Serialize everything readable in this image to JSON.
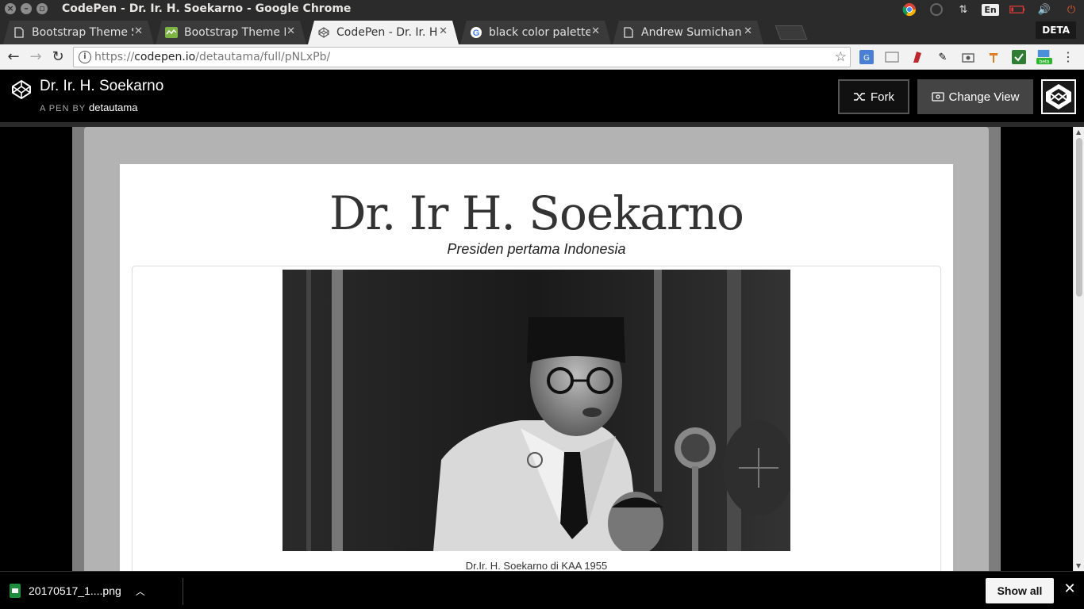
{
  "window": {
    "title": "CodePen - Dr. Ir. H. Soekarno - Google Chrome",
    "close_glyph": "×",
    "min_glyph": "–",
    "max_glyph": "▫"
  },
  "tray": {
    "lang": "En",
    "icons": [
      "chrome-icon",
      "network-icon",
      "transfer-icon",
      "keyboard-icon",
      "battery-icon",
      "volume-icon",
      "power-icon"
    ]
  },
  "tabs": [
    {
      "label": "Bootstrap Theme Sk",
      "icon": "document-icon",
      "active": false
    },
    {
      "label": "Bootstrap Theme Re",
      "icon": "bootstrap-icon",
      "active": false
    },
    {
      "label": "CodePen - Dr. Ir. H.",
      "icon": "codepen-icon",
      "active": true
    },
    {
      "label": "black color palette",
      "icon": "google-icon",
      "active": false
    },
    {
      "label": "Andrew Sumichan |",
      "icon": "document-icon",
      "active": false
    }
  ],
  "profile_label": "DETA",
  "address": {
    "scheme": "https://",
    "host": "codepen.io",
    "path": "/detautama/full/pNLxPb/"
  },
  "codepen": {
    "pen_title": "Dr. Ir. H. Soekarno",
    "by_label": "A PEN BY",
    "author": "detautama",
    "fork_label": "Fork",
    "change_view_label": "Change View"
  },
  "page": {
    "heading": "Dr. Ir H. Soekarno",
    "subheading": "Presiden pertama Indonesia",
    "image_caption": "Dr.Ir. H. Soekarno di KAA 1955"
  },
  "downloads": {
    "file_name": "20170517_1....png",
    "show_all_label": "Show all"
  },
  "colors": {
    "accent_green": "#1e8e3e",
    "header_bg": "#000000",
    "card_bg": "#ffffff"
  }
}
